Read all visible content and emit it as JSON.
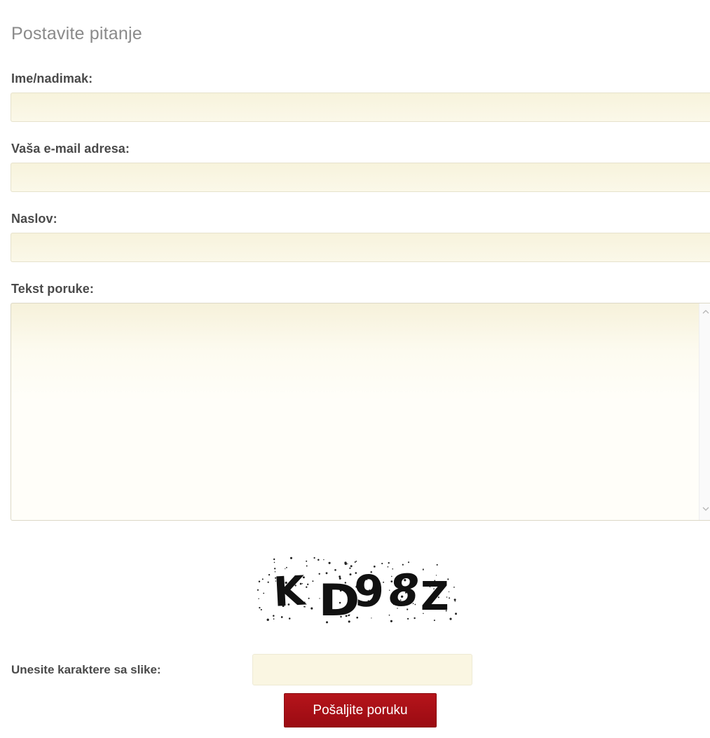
{
  "heading": "Postavite pitanje",
  "fields": {
    "name": {
      "label": "Ime/nadimak:",
      "value": ""
    },
    "email": {
      "label": "Vaša e-mail adresa:",
      "value": ""
    },
    "subject": {
      "label": "Naslov:",
      "value": ""
    },
    "message": {
      "label": "Tekst poruke:",
      "value": ""
    }
  },
  "scrollbar": {
    "up_icon": "chevron-up-icon",
    "down_icon": "chevron-down-icon"
  },
  "captcha": {
    "text": "KD98Z",
    "characters": [
      "K",
      "D",
      "9",
      "8",
      "Z"
    ],
    "label": "Unesite karaktere sa slike:",
    "value": ""
  },
  "submit_label": "Pošaljite poruku",
  "colors": {
    "input_background": "#f7f3dc",
    "button": "#a80f16",
    "label_text": "#4a4a4a",
    "heading_text": "#8a8a8a"
  }
}
